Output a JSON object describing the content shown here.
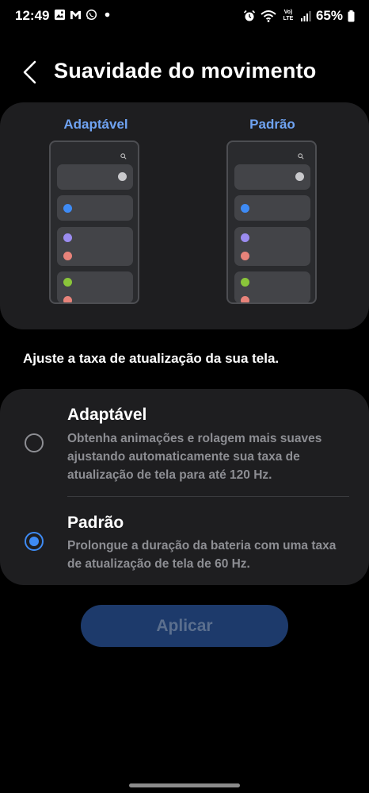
{
  "status_bar": {
    "time": "12:49",
    "battery": "65%",
    "left_icons": [
      "gallery-icon",
      "gmail-icon",
      "whatsapp-icon",
      "dot-icon"
    ],
    "right_icons": [
      "alarm-icon",
      "wifi-icon",
      "volte-icon",
      "signal-icon",
      "battery-icon"
    ],
    "volte_text": "Vo) LTE"
  },
  "header": {
    "title": "Suavidade do movimento"
  },
  "preview": {
    "left_label": "Adaptável",
    "right_label": "Padrão"
  },
  "subtitle": "Ajuste a taxa de atualização da sua tela.",
  "options": [
    {
      "title": "Adaptável",
      "description": "Obtenha animações e rolagem mais suaves ajustando automaticamente sua taxa de atualização de tela para até 120 Hz.",
      "selected": false
    },
    {
      "title": "Padrão",
      "description": "Prolongue a duração da bateria com uma taxa de atualização de tela de 60 Hz.",
      "selected": true
    }
  ],
  "apply_button": "Aplicar",
  "colors": {
    "accent": "#3e8bf5",
    "label_blue": "#6fa3f2",
    "card": "#1e1e20",
    "button_disabled": "#1d3a6b"
  }
}
